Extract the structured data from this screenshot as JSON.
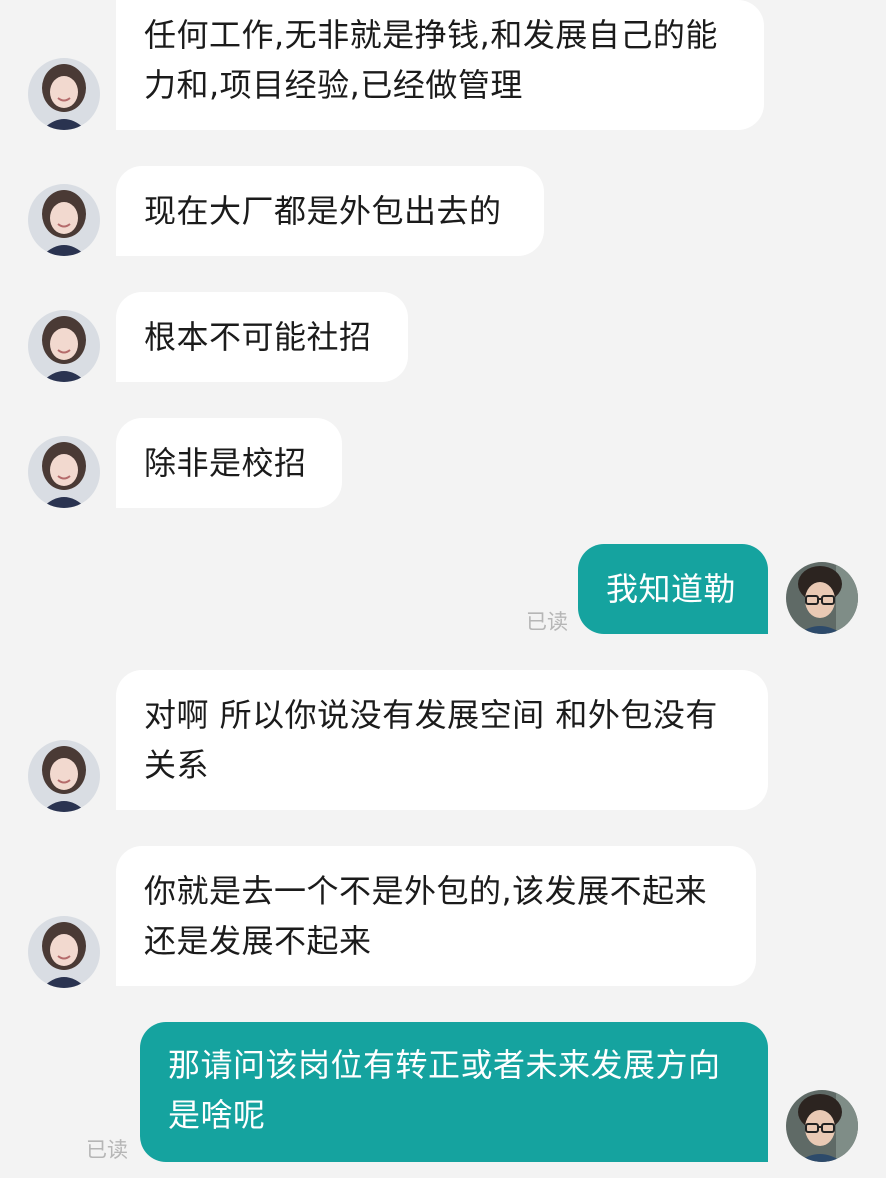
{
  "contacts": {
    "other": {
      "avatar_icon": "female-avatar-icon"
    },
    "me": {
      "avatar_icon": "male-avatar-icon"
    }
  },
  "colors": {
    "background": "#f3f3f3",
    "incoming_bubble": "#ffffff",
    "outgoing_bubble": "#15a39f",
    "read_receipt": "#b6b6b6"
  },
  "messages": [
    {
      "sender": "other",
      "text": "任何工作,无非就是挣钱,和发展自己的能力和,项目经验,已经做管理"
    },
    {
      "sender": "other",
      "text": "现在大厂都是外包出去的"
    },
    {
      "sender": "other",
      "text": "根本不可能社招"
    },
    {
      "sender": "other",
      "text": "除非是校招"
    },
    {
      "sender": "me",
      "text": "我知道勒",
      "receipt": "已读"
    },
    {
      "sender": "other",
      "text": "对啊 所以你说没有发展空间 和外包没有关系"
    },
    {
      "sender": "other",
      "text": "你就是去一个不是外包的,该发展不起来还是发展不起来"
    },
    {
      "sender": "me",
      "text": "那请问该岗位有转正或者未来发展方向是啥呢",
      "receipt": "已读"
    }
  ]
}
